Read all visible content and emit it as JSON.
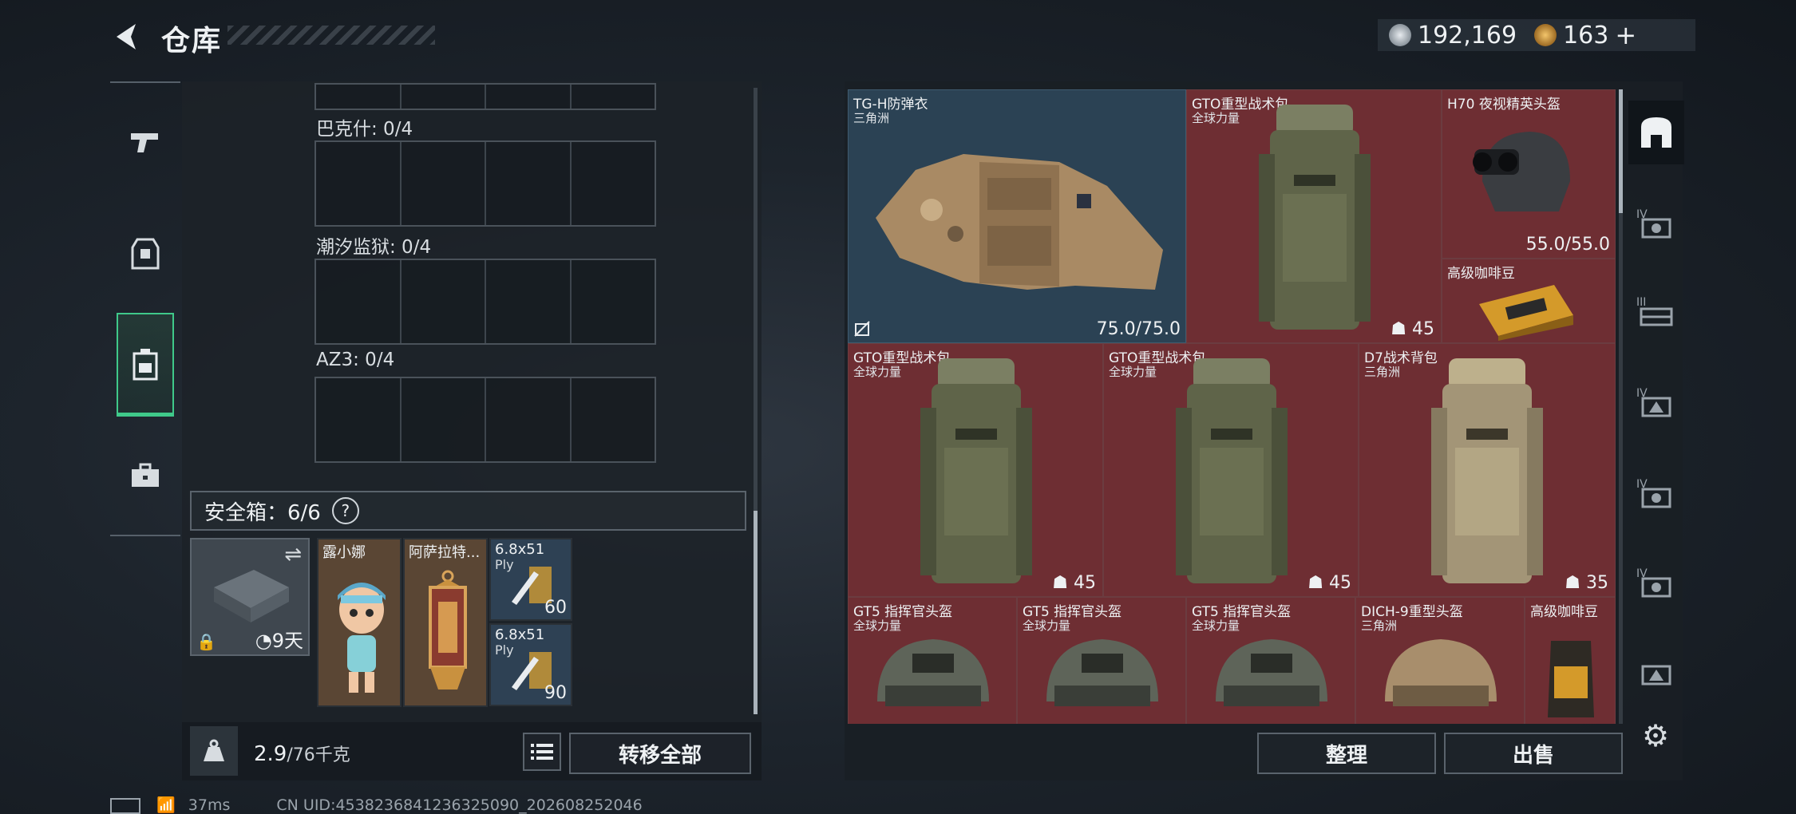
{
  "header": {
    "back_label": "",
    "title": "仓库",
    "currency_a": "192,169",
    "currency_b": "163",
    "plus": "+"
  },
  "left": {
    "slots": [
      {
        "label": "巴克什: 0/4"
      },
      {
        "label": "潮汐监狱: 0/4"
      },
      {
        "label": "AZ3: 0/4"
      }
    ],
    "safebox_label": "安全箱：6/6",
    "help": "?",
    "secure_case": {
      "days": "9天"
    },
    "tiles": [
      {
        "name": "露小娜",
        "count": ""
      },
      {
        "name": "阿萨拉特...",
        "count": ""
      },
      {
        "name": "6.8x51",
        "sub": "Ply",
        "count": "60"
      },
      {
        "name": "6.8x51",
        "sub": "Ply",
        "count": "90"
      }
    ],
    "weight_value": "2.9",
    "weight_max": "/76千克",
    "transfer_all": "转移全部"
  },
  "right": {
    "cells": [
      {
        "name": "TG-H防弹衣",
        "sub": "三角洲",
        "value": "75.0/75.0",
        "kind": "armor"
      },
      {
        "name": "GTO重型战术包",
        "sub": "全球力量",
        "value": "45",
        "kind": "pack"
      },
      {
        "name": "H70 夜视精英头盔",
        "sub": "",
        "value": "55.0/55.0",
        "kind": "nvg"
      },
      {
        "name": "高级咖啡豆",
        "sub": "",
        "value": "",
        "kind": "coffee"
      },
      {
        "name": "GTO重型战术包",
        "sub": "全球力量",
        "value": "45",
        "kind": "pack"
      },
      {
        "name": "GTO重型战术包",
        "sub": "全球力量",
        "value": "45",
        "kind": "pack"
      },
      {
        "name": "D7战术背包",
        "sub": "三角洲",
        "value": "35",
        "kind": "pack-tan"
      },
      {
        "name": "GT5 指挥官头盔",
        "sub": "全球力量",
        "value": "",
        "kind": "helmet"
      },
      {
        "name": "GT5 指挥官头盔",
        "sub": "全球力量",
        "value": "",
        "kind": "helmet"
      },
      {
        "name": "GT5 指挥官头盔",
        "sub": "全球力量",
        "value": "",
        "kind": "helmet"
      },
      {
        "name": "DICH-9重型头盔",
        "sub": "三角洲",
        "value": "",
        "kind": "helmet-tan"
      },
      {
        "name": "高级咖啡豆",
        "sub": "",
        "value": "",
        "kind": "coffee-bag"
      }
    ],
    "organize": "整理",
    "sell": "出售"
  },
  "status": {
    "ping": "37ms",
    "uid": "CN UID:4538236841236325090_202608252046"
  },
  "colors": {
    "accent_green": "#3fc98a",
    "cell_red": "#6e2e33",
    "cell_blue": "#2b4254"
  }
}
